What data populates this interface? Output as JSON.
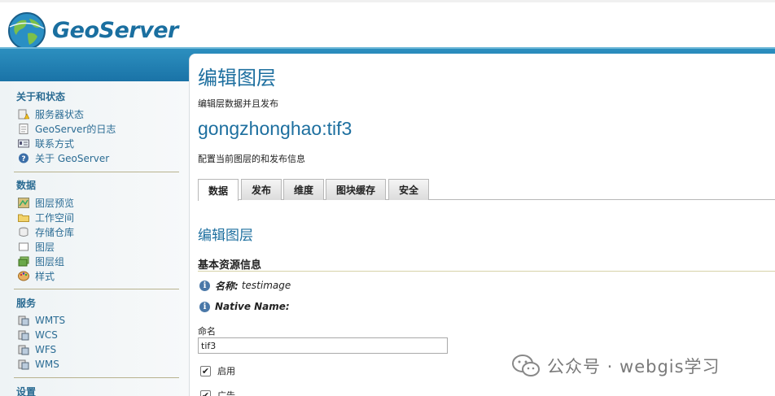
{
  "header": {
    "logo_text": "GeoServer"
  },
  "sidebar": {
    "sections": [
      {
        "title": "关于和状态",
        "items": [
          {
            "label": "服务器状态",
            "icon": "warning-icon"
          },
          {
            "label": "GeoServer的日志",
            "icon": "document-icon"
          },
          {
            "label": "联系方式",
            "icon": "contact-card-icon"
          },
          {
            "label": "关于 GeoServer",
            "icon": "help-icon"
          }
        ]
      },
      {
        "title": "数据",
        "items": [
          {
            "label": "图层预览",
            "icon": "map-preview-icon"
          },
          {
            "label": "工作空间",
            "icon": "folder-icon"
          },
          {
            "label": "存储仓库",
            "icon": "database-icon"
          },
          {
            "label": "图层",
            "icon": "layer-icon"
          },
          {
            "label": "图层组",
            "icon": "layer-group-icon"
          },
          {
            "label": "样式",
            "icon": "palette-icon"
          }
        ]
      },
      {
        "title": "服务",
        "items": [
          {
            "label": "WMTS",
            "icon": "service-icon"
          },
          {
            "label": "WCS",
            "icon": "service-icon"
          },
          {
            "label": "WFS",
            "icon": "service-icon"
          },
          {
            "label": "WMS",
            "icon": "service-icon"
          }
        ]
      },
      {
        "title": "设置",
        "items": []
      }
    ]
  },
  "main": {
    "title": "编辑图层",
    "subtitle": "编辑层数据并且发布",
    "layer_name": "gongzhonghao:tif3",
    "description": "配置当前图层的和发布信息",
    "tabs": [
      {
        "label": "数据",
        "active": true
      },
      {
        "label": "发布",
        "active": false
      },
      {
        "label": "维度",
        "active": false
      },
      {
        "label": "图块缓存",
        "active": false
      },
      {
        "label": "安全",
        "active": false
      }
    ],
    "section_title": "编辑图层",
    "basic_info_title": "基本资源信息",
    "info": [
      {
        "label": "名称:",
        "value": "testimage"
      },
      {
        "label": "Native Name:",
        "value": ""
      }
    ],
    "name_field": {
      "label": "命名",
      "value": "tif3"
    },
    "checkboxes": [
      {
        "label": "启用",
        "checked": true
      },
      {
        "label": "广告",
        "checked": true
      }
    ]
  },
  "watermark": {
    "text": "公众号 · webgis学习"
  },
  "colors": {
    "accent": "#1d6f9f",
    "bar": "#1a73a7",
    "link": "#2b6c94"
  }
}
